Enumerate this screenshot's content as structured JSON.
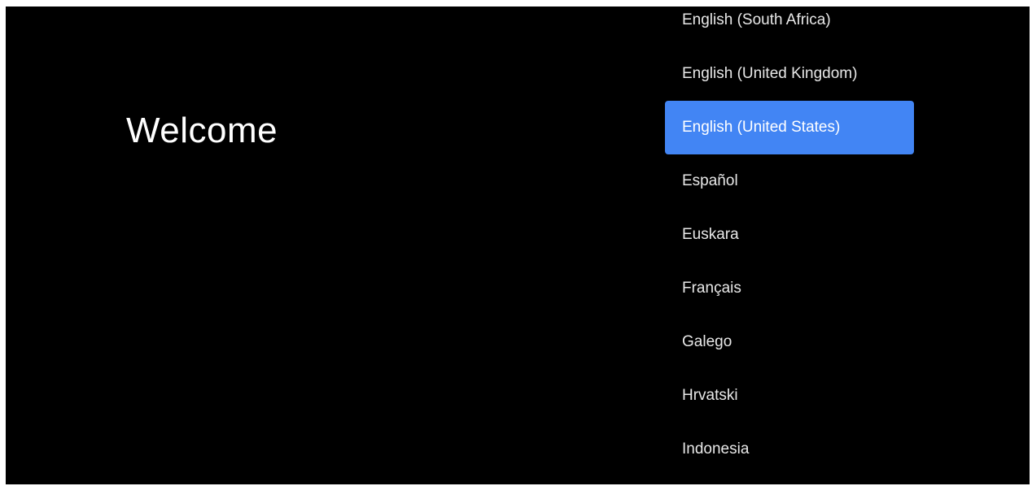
{
  "welcome": {
    "title": "Welcome"
  },
  "language_list": {
    "selected_index": 2,
    "selected_color": "#4285F4",
    "items": [
      {
        "label": "English (South Africa)"
      },
      {
        "label": "English (United Kingdom)"
      },
      {
        "label": "English (United States)"
      },
      {
        "label": "Español"
      },
      {
        "label": "Euskara"
      },
      {
        "label": "Français"
      },
      {
        "label": "Galego"
      },
      {
        "label": "Hrvatski"
      },
      {
        "label": "Indonesia"
      }
    ]
  }
}
